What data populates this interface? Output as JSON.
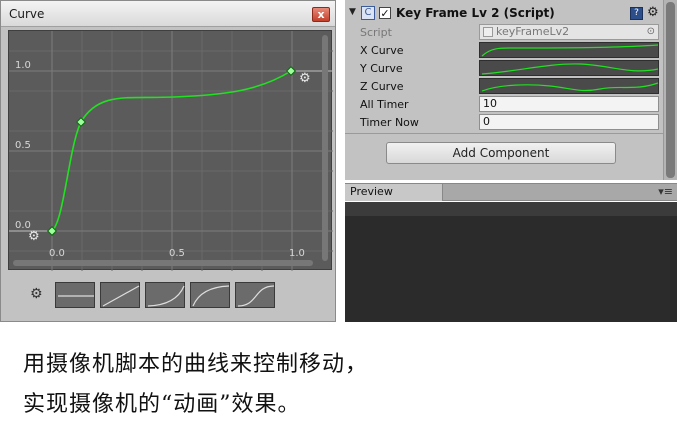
{
  "curve_window": {
    "title": "Curve",
    "close_glyph": "x",
    "y_ticks": [
      "1.0",
      "0.5",
      "0.0"
    ],
    "x_ticks": [
      "0.0",
      "0.5",
      "1.0"
    ],
    "curve_color": "#22e022",
    "presets": [
      "linear-flat",
      "linear-ramp",
      "ease-in",
      "ease-out",
      "ease-in-out"
    ]
  },
  "inspector": {
    "component_title": "Key Frame Lv 2 (Script)",
    "enabled": true,
    "rows": [
      {
        "label": "Script",
        "type": "object",
        "value": "keyFrameLv2"
      },
      {
        "label": "X Curve",
        "type": "curve"
      },
      {
        "label": "Y Curve",
        "type": "curve"
      },
      {
        "label": "Z Curve",
        "type": "curve"
      },
      {
        "label": "All Timer",
        "type": "number",
        "value": "10"
      },
      {
        "label": "Timer Now",
        "type": "number",
        "value": "0"
      }
    ],
    "add_component_label": "Add Component"
  },
  "preview": {
    "tab_label": "Preview",
    "menu_glyph": "▾≡"
  },
  "caption": {
    "line1": "用摄像机脚本的曲线来控制移动，",
    "line2": "实现摄像机的“动画”效果。"
  },
  "icons": [
    "gear-icon",
    "close-icon",
    "script-icon",
    "reference-icon",
    "checkbox-icon"
  ]
}
